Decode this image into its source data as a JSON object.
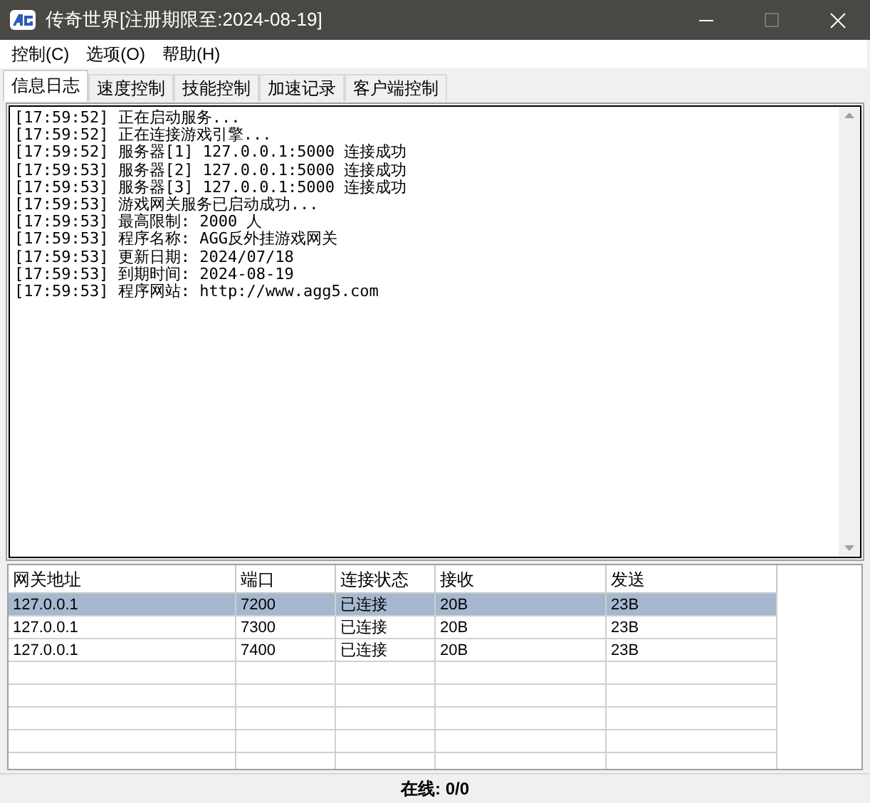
{
  "window": {
    "title": "传奇世界[注册期限至:2024-08-19]"
  },
  "menu": [
    "控制(C)",
    "选项(O)",
    "帮助(H)"
  ],
  "tabs": [
    {
      "label": "信息日志",
      "selected": true
    },
    {
      "label": "速度控制",
      "selected": false
    },
    {
      "label": "技能控制",
      "selected": false
    },
    {
      "label": "加速记录",
      "selected": false
    },
    {
      "label": "客户端控制",
      "selected": false
    }
  ],
  "log": [
    "[17:59:52] 正在启动服务...",
    "[17:59:52] 正在连接游戏引擎...",
    "[17:59:52] 服务器[1] 127.0.0.1:5000 连接成功",
    "[17:59:53] 服务器[2] 127.0.0.1:5000 连接成功",
    "[17:59:53] 服务器[3] 127.0.0.1:5000 连接成功",
    "[17:59:53] 游戏网关服务已启动成功...",
    "[17:59:53] 最高限制: 2000 人",
    "[17:59:53] 程序名称: AGG反外挂游戏网关",
    "[17:59:53] 更新日期: 2024/07/18",
    "[17:59:53] 到期时间: 2024-08-19",
    "[17:59:53] 程序网站: http://www.agg5.com"
  ],
  "table": {
    "columns": [
      "网关地址",
      "端口",
      "连接状态",
      "接收",
      "发送"
    ],
    "rows": [
      {
        "cells": [
          "127.0.0.1",
          "7200",
          "已连接",
          "20B",
          "23B"
        ],
        "selected": true
      },
      {
        "cells": [
          "127.0.0.1",
          "7300",
          "已连接",
          "20B",
          "23B"
        ],
        "selected": false
      },
      {
        "cells": [
          "127.0.0.1",
          "7400",
          "已连接",
          "20B",
          "23B"
        ],
        "selected": false
      }
    ]
  },
  "status_bar": "在线: 0/0"
}
